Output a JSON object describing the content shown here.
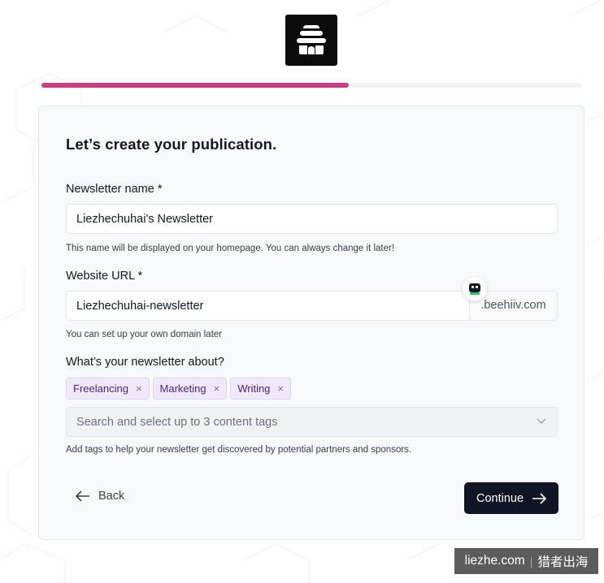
{
  "progress": {
    "fraction": 0.57
  },
  "colors": {
    "accent": "#cc3e80",
    "primary_button": "#0f1525",
    "tag_bg": "#efe9fb"
  },
  "form": {
    "title": "Let’s create your publication.",
    "newsletter_name": {
      "label": "Newsletter name *",
      "value": "Liezhechuhai's Newsletter",
      "help": "This name will be displayed on your homepage. You can always change it later!"
    },
    "website_url": {
      "label": "Website URL *",
      "value": "Liezhechuhai-newsletter",
      "suffix": ".beehiiv.com",
      "help": "You can set up your own domain later"
    },
    "about": {
      "label": "What’s your newsletter about?",
      "tags": [
        "Freelancing",
        "Marketing",
        "Writing"
      ],
      "tag_remove": "×",
      "select_placeholder": "Search and select up to 3 content tags",
      "help": "Add tags to help your newsletter get discovered by potential partners and sponsors."
    }
  },
  "actions": {
    "back_label": "Back",
    "continue_label": "Continue"
  },
  "watermark": {
    "site": "liezhe.com",
    "sep": "|",
    "name": "猎者出海"
  },
  "icons": {
    "logo": "beehive-logo-icon",
    "bot": "robot-helper-icon",
    "chevron": "chevron-down-icon",
    "back": "arrow-left-icon",
    "continue": "arrow-right-icon",
    "remove": "close-icon"
  }
}
